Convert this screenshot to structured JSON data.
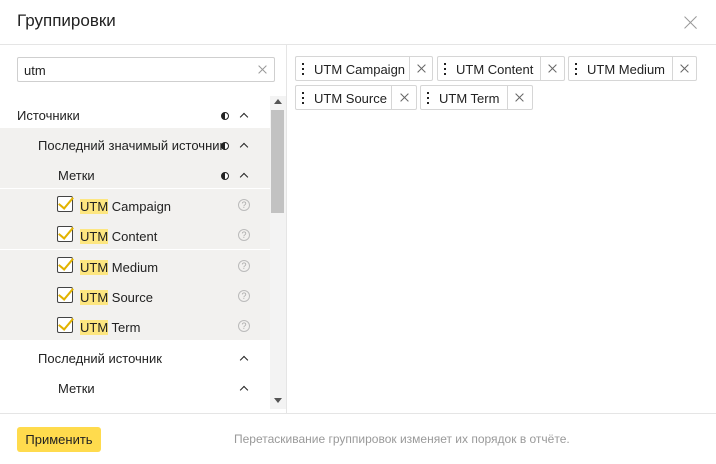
{
  "dialog": {
    "title": "Группировки"
  },
  "search": {
    "value": "utm",
    "clear_icon": "close-icon"
  },
  "tree": {
    "sources": {
      "label": "Источники",
      "icon": "half-circle-icon"
    },
    "last_significant": {
      "label": "Последний значимый источник",
      "icon": "half-circle-icon"
    },
    "tags1": {
      "label": "Метки",
      "icon": "half-circle-icon"
    },
    "items": [
      {
        "highlight": "UTM",
        "rest": " Campaign",
        "checked": true
      },
      {
        "highlight": "UTM",
        "rest": " Content",
        "checked": true
      },
      {
        "highlight": "UTM",
        "rest": " Medium",
        "checked": true
      },
      {
        "highlight": "UTM",
        "rest": " Source",
        "checked": true
      },
      {
        "highlight": "UTM",
        "rest": " Term",
        "checked": true
      }
    ],
    "help_glyph": "?",
    "last_source": {
      "label": "Последний источник"
    },
    "tags2": {
      "label": "Метки"
    }
  },
  "selected": [
    {
      "label": "UTM Campaign"
    },
    {
      "label": "UTM Content"
    },
    {
      "label": "UTM Medium"
    },
    {
      "label": "UTM Source"
    },
    {
      "label": "UTM Term"
    }
  ],
  "footer": {
    "apply_label": "Применить",
    "hint": "Перетаскивание группировок изменяет их порядок в отчёте."
  },
  "colors": {
    "accent": "#ffdb4d",
    "highlight": "#fde680",
    "check": "#e2b300",
    "row_bg": "#f2f1ef"
  }
}
